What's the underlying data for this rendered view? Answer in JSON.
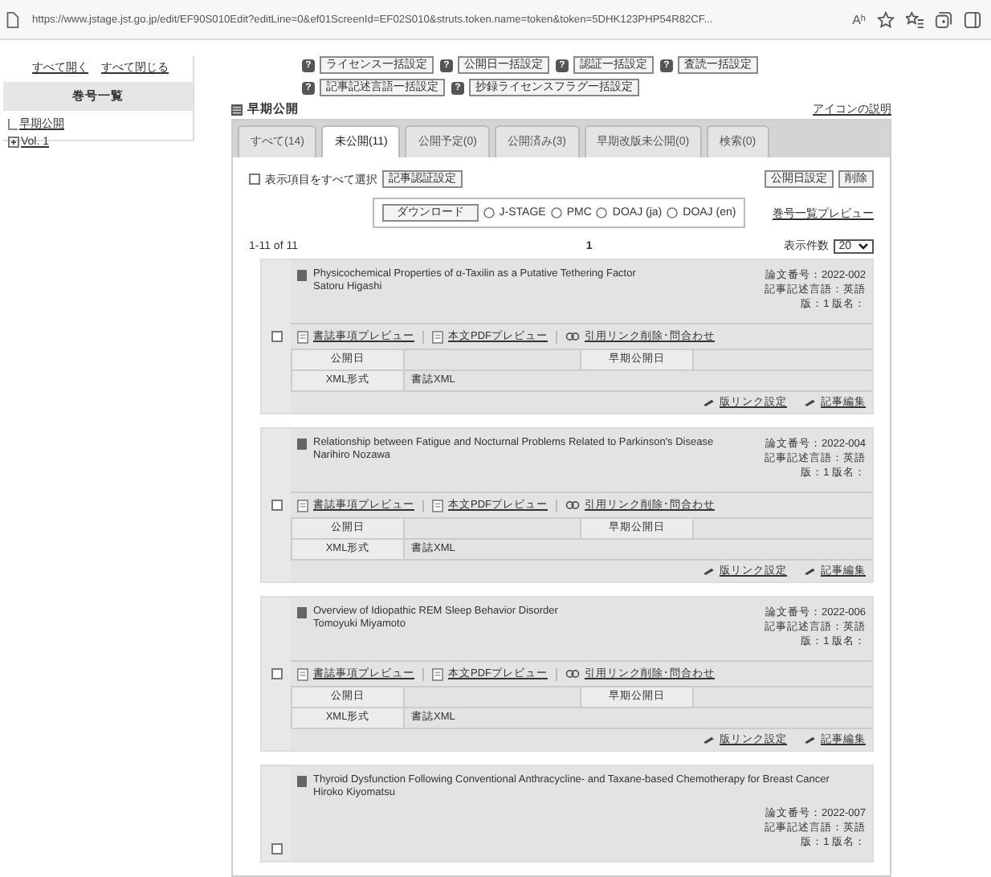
{
  "browser": {
    "url": "https://www.jstage.jst.go.jp/edit/EF90S010Edit?editLine=0&ef01ScreenId=EF02S010&struts.token.name=token&token=5DHK123PHP54R82CF...",
    "reader_label": "Aʰ"
  },
  "sidebar": {
    "expand_all": "すべて開く",
    "collapse_all": "すべて閉じる",
    "heading": "巻号一覧",
    "items": [
      {
        "label": "早期公開",
        "kind": "leaf"
      },
      {
        "label": "Vol. 1",
        "kind": "folder"
      }
    ]
  },
  "bulk_buttons": [
    {
      "help": "?",
      "label": "ライセンス一括設定"
    },
    {
      "help": "?",
      "label": "公開日一括設定"
    },
    {
      "help": "?",
      "label": "認証一括設定"
    },
    {
      "help": "?",
      "label": "査読一括設定"
    },
    {
      "help": "?",
      "label": "記事記述言語一括設定"
    },
    {
      "help": "?",
      "label": "抄録ライセンスフラグ一括設定"
    }
  ],
  "section": {
    "title": "早期公開",
    "help_link": "アイコンの説明"
  },
  "tabs": [
    {
      "label": "すべて(14)",
      "selected": false
    },
    {
      "label": "未公開(11)",
      "selected": true
    },
    {
      "label": "公開予定(0)",
      "selected": false
    },
    {
      "label": "公開済み(3)",
      "selected": false
    },
    {
      "label": "早期改版未公開(0)",
      "selected": false
    },
    {
      "label": "検索(0)",
      "selected": false
    }
  ],
  "select_all": {
    "label": "表示項目をすべて選択",
    "checked": false
  },
  "auth_button": "記事認証設定",
  "right_buttons": [
    "公開日設定",
    "削除"
  ],
  "download": {
    "button": "ダウンロード",
    "options": [
      {
        "label": "J-STAGE",
        "selected": false
      },
      {
        "label": "PMC",
        "selected": false
      },
      {
        "label": "DOAJ (ja)",
        "selected": false
      },
      {
        "label": "DOAJ (en)",
        "selected": false
      }
    ]
  },
  "preview_link": "巻号一覧プレビュー",
  "pagination": {
    "range": "1-11 of 11",
    "page": "1",
    "per_page_label": "表示件数",
    "per_page": "20"
  },
  "articles": [
    {
      "title": "Physicochemical Properties of α-Taxilin as a Putative Tethering Factor",
      "author": "Satoru Higashi",
      "number": "論文番号：2022-002",
      "language": "記事記述言語：英語",
      "edition": "版：1 版名：",
      "checked": false,
      "links": [
        "書誌事項プレビュー",
        "本文PDFプレビュー",
        "引用リンク削除･問合わせ"
      ],
      "fields": [
        {
          "label": "公開日"
        },
        {
          "label": "早期公開日"
        },
        {
          "label": "XML形式",
          "value": "書誌XML"
        }
      ],
      "actions": [
        "版リンク設定",
        "記事編集"
      ]
    },
    {
      "title": "Relationship between Fatigue and Nocturnal Problems Related to Parkinson's Disease",
      "author": "Narihiro Nozawa",
      "number": "論文番号：2022-004",
      "language": "記事記述言語：英語",
      "edition": "版：1 版名：",
      "checked": false,
      "links": [
        "書誌事項プレビュー",
        "本文PDFプレビュー",
        "引用リンク削除･問合わせ"
      ],
      "fields": [
        {
          "label": "公開日"
        },
        {
          "label": "早期公開日"
        },
        {
          "label": "XML形式",
          "value": "書誌XML"
        }
      ],
      "actions": [
        "版リンク設定",
        "記事編集"
      ]
    },
    {
      "title": "Overview of Idiopathic REM Sleep Behavior Disorder",
      "author": "Tomoyuki Miyamoto",
      "number": "論文番号：2022-006",
      "language": "記事記述言語：英語",
      "edition": "版：1 版名：",
      "checked": false,
      "links": [
        "書誌事項プレビュー",
        "本文PDFプレビュー",
        "引用リンク削除･問合わせ"
      ],
      "fields": [
        {
          "label": "公開日"
        },
        {
          "label": "早期公開日"
        },
        {
          "label": "XML形式",
          "value": "書誌XML"
        }
      ],
      "actions": [
        "版リンク設定",
        "記事編集"
      ]
    },
    {
      "title": "Thyroid Dysfunction Following Conventional Anthracycline- and Taxane-based Chemotherapy for Breast Cancer",
      "author": "Hiroko Kiyomatsu",
      "number": "論文番号：2022-007",
      "language": "記事記述言語：英語",
      "edition": "版：1 版名：",
      "checked": false
    }
  ]
}
